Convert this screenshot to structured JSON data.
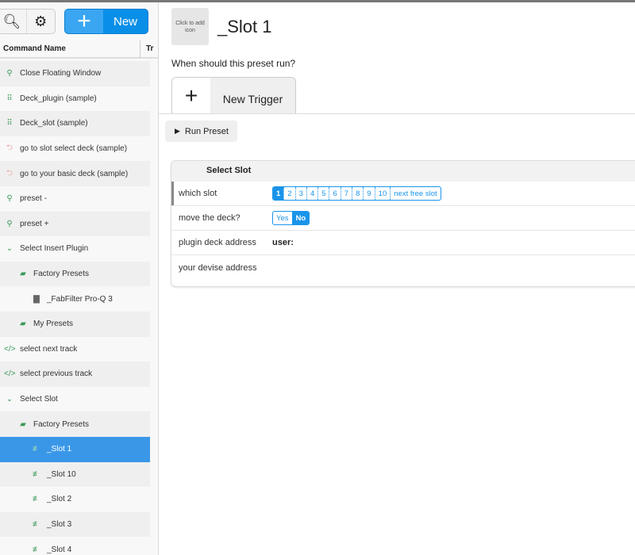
{
  "toolbar": {
    "new_label": "New"
  },
  "columns": {
    "name": "Command Name",
    "second": "Tr"
  },
  "items": [
    {
      "label": "Close Floating Window",
      "icon": "branch-icon",
      "glyph": "⚲",
      "indent": 0
    },
    {
      "label": "Deck_plugin (sample)",
      "icon": "grid-icon",
      "glyph": "⠿",
      "indent": 0
    },
    {
      "label": "Deck_slot (sample)",
      "icon": "grid-icon",
      "glyph": "⠿",
      "indent": 0
    },
    {
      "label": "go to slot select deck (sample)",
      "icon": "return-icon",
      "glyph": "⮌",
      "indent": 0
    },
    {
      "label": "go to your basic deck (sample)",
      "icon": "return-icon",
      "glyph": "⮌",
      "indent": 0
    },
    {
      "label": "preset -",
      "icon": "branch-icon",
      "glyph": "⚲",
      "indent": 0
    },
    {
      "label": "preset +",
      "icon": "branch-icon",
      "glyph": "⚲",
      "indent": 0
    },
    {
      "label": "Select Insert Plugin",
      "icon": "chevron-down-icon",
      "glyph": "⌄",
      "indent": 0
    },
    {
      "label": "Factory Presets",
      "icon": "folder-icon",
      "glyph": "▰",
      "indent": 1
    },
    {
      "label": "_FabFilter Pro-Q 3",
      "icon": "plugin-thumbnail-icon",
      "glyph": "▇",
      "indent": 2
    },
    {
      "label": "My Presets",
      "icon": "folder-icon",
      "glyph": "▰",
      "indent": 1
    },
    {
      "label": "select next track",
      "icon": "code-icon",
      "glyph": "</>",
      "indent": 0
    },
    {
      "label": "select previous track",
      "icon": "code-icon",
      "glyph": "</>",
      "indent": 0
    },
    {
      "label": "Select Slot",
      "icon": "chevron-down-icon",
      "glyph": "⌄",
      "indent": 0
    },
    {
      "label": "Factory Presets",
      "icon": "folder-icon",
      "glyph": "▰",
      "indent": 1
    },
    {
      "label": "_Slot 1",
      "icon": "sliders-icon",
      "glyph": "≢",
      "indent": 2,
      "selected": true
    },
    {
      "label": "_Slot 10",
      "icon": "sliders-icon",
      "glyph": "≢",
      "indent": 2
    },
    {
      "label": "_Slot 2",
      "icon": "sliders-icon",
      "glyph": "≢",
      "indent": 2
    },
    {
      "label": "_Slot 3",
      "icon": "sliders-icon",
      "glyph": "≢",
      "indent": 2
    },
    {
      "label": "_Slot 4",
      "icon": "sliders-icon",
      "glyph": "≢",
      "indent": 2
    }
  ],
  "main": {
    "icon_placeholder": "Click to add icon",
    "title": "_Slot 1",
    "question": "When should this preset run?",
    "new_trigger": "New Trigger",
    "run_preset": "Run Preset",
    "panel": {
      "title": "Select Slot",
      "which_slot_label": "which slot",
      "slots": [
        "1",
        "2",
        "3",
        "4",
        "5",
        "6",
        "7",
        "8",
        "9",
        "10",
        "next free slot"
      ],
      "selected_slot": "1",
      "move_label": "move the deck?",
      "move_options": [
        "Yes",
        "No"
      ],
      "move_selected": "No",
      "plugin_label": "plugin deck address",
      "plugin_value": "user:",
      "device_label": "your devise address"
    }
  },
  "colors": {
    "accent": "#1a94ea",
    "selected_row": "#3a97e8",
    "icon_green": "#3a9a5a"
  }
}
